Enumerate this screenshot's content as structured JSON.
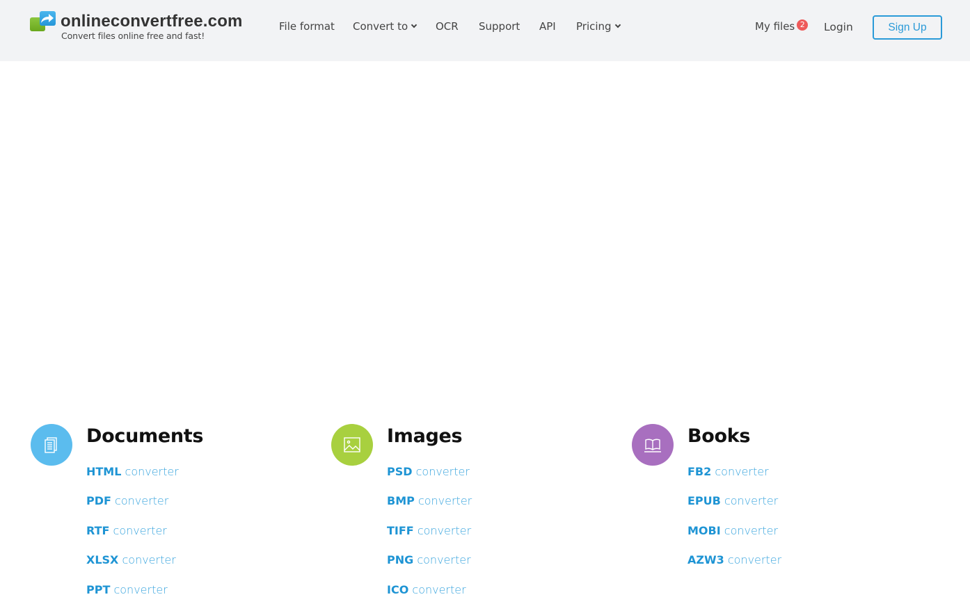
{
  "header": {
    "logo_title": "onlineconvertfree.com",
    "logo_tagline": "Convert files online free and fast!",
    "nav": [
      {
        "label": "File format",
        "dropdown": false
      },
      {
        "label": "Convert to",
        "dropdown": true
      },
      {
        "label": "OCR",
        "dropdown": false
      },
      {
        "label": "Support",
        "dropdown": false
      },
      {
        "label": "API",
        "dropdown": false
      },
      {
        "label": "Pricing",
        "dropdown": true
      }
    ],
    "my_files_label": "My files",
    "my_files_count": "2",
    "login_label": "Login",
    "signup_label": "Sign Up"
  },
  "colors": {
    "header_bg": "#f2f3f5",
    "accent": "#2a9ad8",
    "badge": "#ee5a5a",
    "documents": "#5bbcee",
    "images": "#a8d03f",
    "books": "#a86fbf"
  },
  "categories": [
    {
      "title": "Documents",
      "icon": "documents-icon",
      "links": [
        {
          "format": "HTML",
          "suffix": "converter"
        },
        {
          "format": "PDF",
          "suffix": "converter"
        },
        {
          "format": "RTF",
          "suffix": "converter"
        },
        {
          "format": "XLSX",
          "suffix": "converter"
        },
        {
          "format": "PPT",
          "suffix": "converter"
        }
      ]
    },
    {
      "title": "Images",
      "icon": "image-icon",
      "links": [
        {
          "format": "PSD",
          "suffix": "converter"
        },
        {
          "format": "BMP",
          "suffix": "converter"
        },
        {
          "format": "TIFF",
          "suffix": "converter"
        },
        {
          "format": "PNG",
          "suffix": "converter"
        },
        {
          "format": "ICO",
          "suffix": "converter"
        }
      ]
    },
    {
      "title": "Books",
      "icon": "book-icon",
      "links": [
        {
          "format": "FB2",
          "suffix": "converter"
        },
        {
          "format": "EPUB",
          "suffix": "converter"
        },
        {
          "format": "MOBI",
          "suffix": "converter"
        },
        {
          "format": "AZW3",
          "suffix": "converter"
        }
      ]
    }
  ]
}
